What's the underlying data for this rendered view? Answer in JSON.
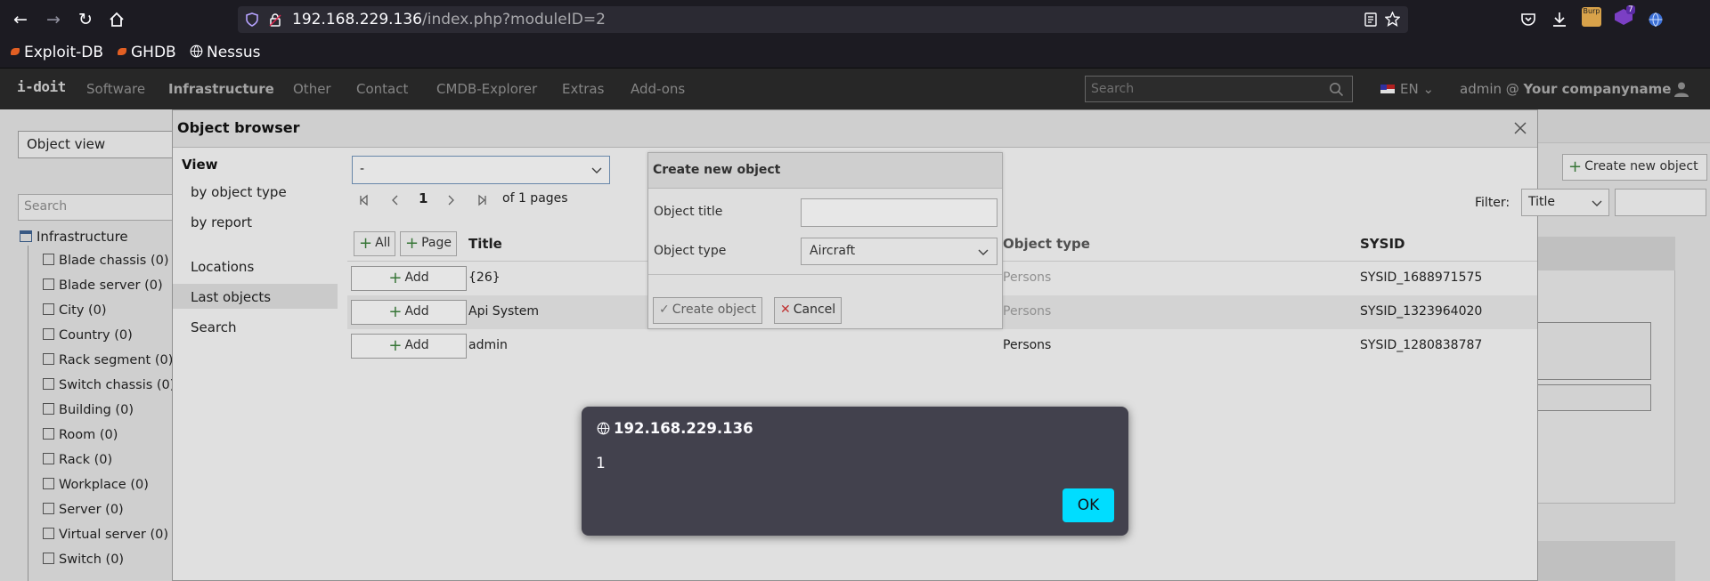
{
  "browser": {
    "url_host": "192.168.229.136",
    "url_path": "/index.php?moduleID=2",
    "bookmarks": [
      "Exploit-DB",
      "GHDB",
      "Nessus"
    ]
  },
  "app": {
    "logo": "i-doit",
    "nav": [
      "Software",
      "Infrastructure",
      "Other",
      "Contact",
      "CMDB-Explorer",
      "Extras",
      "Add-ons"
    ],
    "search_placeholder": "Search",
    "language": "EN",
    "user_prefix": "admin @ ",
    "company": "Your companyname"
  },
  "background_page": {
    "view_select": "Object view",
    "left_search_placeholder": "Search",
    "tree_root": "Infrastructure",
    "tree_items": [
      "Blade chassis (0)",
      "Blade server (0)",
      "City (0)",
      "Country (0)",
      "Rack segment (0)",
      "Switch chassis (0)",
      "Building (0)",
      "Room (0)",
      "Rack (0)",
      "Workplace (0)",
      "Server (0)",
      "Virtual server (0)",
      "Switch (0)"
    ]
  },
  "object_browser": {
    "title": "Object browser",
    "view_heading": "View",
    "side_items": [
      "by object type",
      "by report",
      "Locations",
      "Last objects",
      "Search"
    ],
    "type_select_value": "-",
    "page_current": "1",
    "page_of": "of 1 pages",
    "create_new_button": "Create new object",
    "filter_label": "Filter:",
    "filter_select_value": "Title",
    "all_button": "All",
    "page_button": "Page",
    "columns": [
      "Title",
      "Object type",
      "SYSID"
    ],
    "add_label": "Add",
    "rows": [
      {
        "title": "{26}",
        "type": "Persons",
        "sysid": "SYSID_1688971575"
      },
      {
        "title": "Api System",
        "type": "Persons",
        "sysid": "SYSID_1323964020"
      },
      {
        "title": "admin",
        "type": "Persons",
        "sysid": "SYSID_1280838787"
      }
    ]
  },
  "create_dialog": {
    "title": "Create new object",
    "title_label": "Object title",
    "type_label": "Object type",
    "type_value": "Aircraft",
    "create_button": "Create object",
    "cancel_button": "Cancel"
  },
  "alert": {
    "origin": "192.168.229.136",
    "message": "1",
    "ok_label": "OK"
  }
}
